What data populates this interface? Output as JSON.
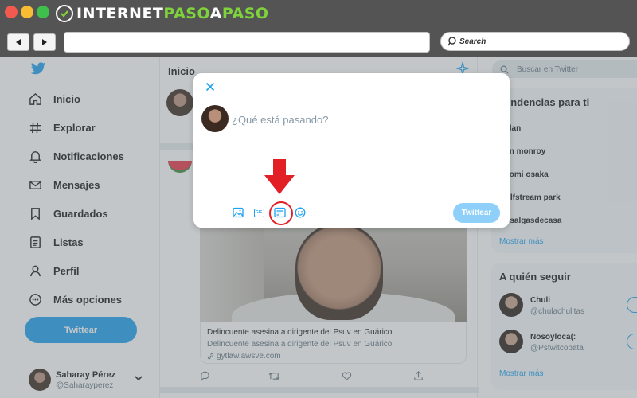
{
  "browser": {
    "logo": {
      "part1": "INTERNET",
      "part2": "PASO",
      "part3": "A",
      "part4": "PASO"
    },
    "search_label": "Search",
    "address_value": ""
  },
  "sidebar": {
    "items": [
      {
        "label": "Inicio",
        "icon": "home-icon"
      },
      {
        "label": "Explorar",
        "icon": "hashtag-icon"
      },
      {
        "label": "Notificaciones",
        "icon": "bell-icon"
      },
      {
        "label": "Mensajes",
        "icon": "envelope-icon"
      },
      {
        "label": "Guardados",
        "icon": "bookmark-icon"
      },
      {
        "label": "Listas",
        "icon": "list-icon"
      },
      {
        "label": "Perfil",
        "icon": "user-icon"
      },
      {
        "label": "Más opciones",
        "icon": "more-icon"
      }
    ],
    "tweet_button": "Twittear",
    "profile": {
      "name": "Saharay Pérez",
      "handle": "@Saharayperez"
    }
  },
  "timeline": {
    "title": "Inicio",
    "card": {
      "title": "Delincuente asesina a dirigente del Psuv en Guárico",
      "description": "Delincuente asesina a dirigente del Psuv en Guárico",
      "url": "gytlaw.awsve.com"
    }
  },
  "right": {
    "search_placeholder": "Buscar en Twitter",
    "trends_title": "Tendencias para ti",
    "trends": [
      "Dylan",
      "Ben monroy",
      "Naomi osaka",
      "Gulfstream park",
      "Rosalgasdecasa"
    ],
    "trends_more": "Mostrar más",
    "follow_title": "A quién seguir",
    "follow": [
      {
        "name": "Chuli",
        "handle": "@chulachulitas"
      },
      {
        "name": "Nosoyloca(:",
        "handle": "@Pstwitcopata"
      }
    ],
    "follow_more": "Mostrar más"
  },
  "compose": {
    "placeholder": "¿Qué está pasando?",
    "gif_label": "GIF",
    "submit": "Twittear"
  },
  "colors": {
    "twitter_blue": "#1da1f2",
    "highlight_red": "#e31f26",
    "overlay": "#6e767d"
  }
}
